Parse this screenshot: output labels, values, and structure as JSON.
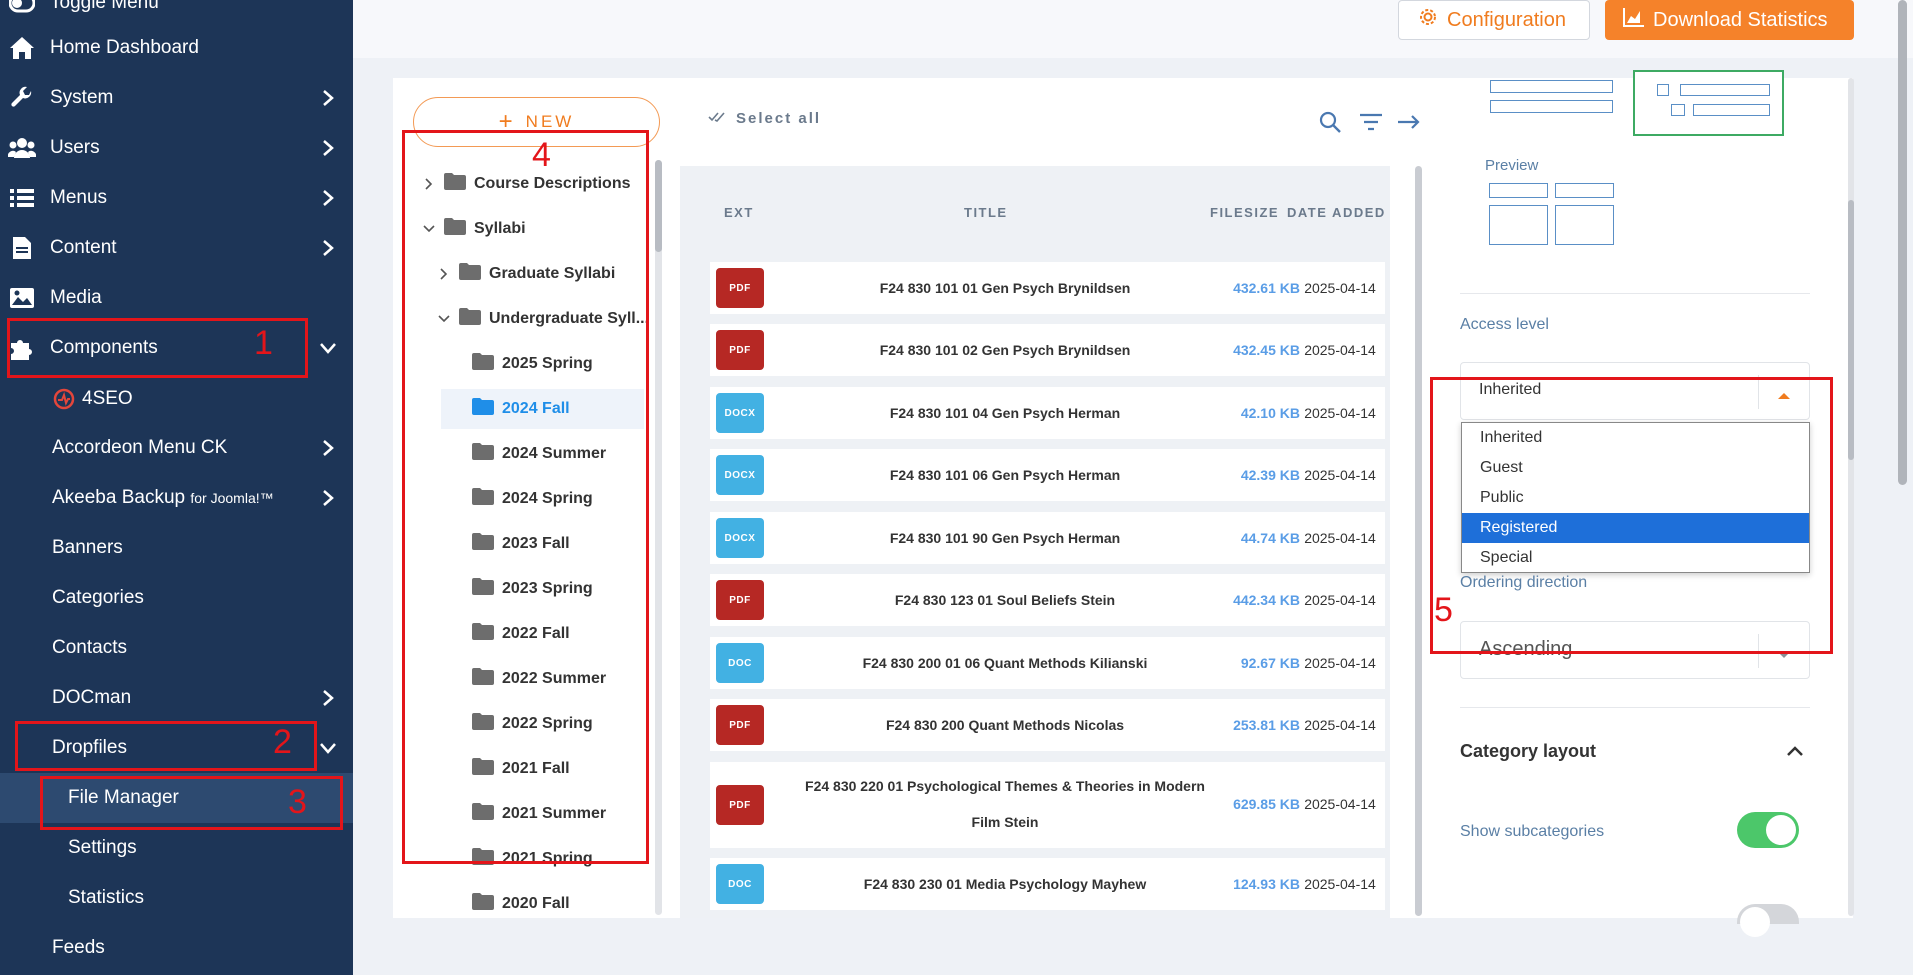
{
  "sidebar": {
    "toggle_label": "Toggle Menu",
    "items": [
      {
        "label": "Home Dashboard",
        "icon": "home-icon",
        "chevron": ""
      },
      {
        "label": "System",
        "icon": "wrench-icon",
        "chevron": "right"
      },
      {
        "label": "Users",
        "icon": "users-icon",
        "chevron": "right"
      },
      {
        "label": "Menus",
        "icon": "list-icon",
        "chevron": "right"
      },
      {
        "label": "Content",
        "icon": "document-icon",
        "chevron": "right"
      },
      {
        "label": "Media",
        "icon": "image-icon",
        "chevron": ""
      },
      {
        "label": "Components",
        "icon": "puzzle-icon",
        "chevron": "down"
      }
    ],
    "components": [
      {
        "label": "4SEO",
        "suffix": ""
      },
      {
        "label": "Accordeon Menu CK",
        "suffix": ""
      },
      {
        "label": "Akeeba Backup",
        "suffix": "for Joomla!™"
      },
      {
        "label": "Banners",
        "suffix": ""
      },
      {
        "label": "Categories",
        "suffix": ""
      },
      {
        "label": "Contacts",
        "suffix": ""
      },
      {
        "label": "DOCman",
        "suffix": ""
      },
      {
        "label": "Dropfiles",
        "suffix": ""
      }
    ],
    "dropfiles_sub": [
      "File Manager",
      "Settings",
      "Statistics"
    ],
    "feeds": "Feeds"
  },
  "header": {
    "config_label": "Configuration",
    "stats_label": "Download Statistics",
    "accent": "#f5822a"
  },
  "tree": {
    "new_label": "NEW",
    "items": [
      "Course Descriptions",
      "Syllabi",
      "Graduate Syllabi",
      "Undergraduate Syll...",
      "2025 Spring",
      "2024 Fall",
      "2024 Summer",
      "2024 Spring",
      "2023 Fall",
      "2023 Spring",
      "2022 Fall",
      "2022 Summer",
      "2022 Spring",
      "2021 Fall",
      "2021 Summer",
      "2021 Spring",
      "2020 Fall"
    ],
    "selected": "2024 Fall"
  },
  "files": {
    "select_all": "Select all",
    "columns": {
      "ext": "EXT",
      "title": "TITLE",
      "size": "FILESIZE",
      "date": "DATE ADDED"
    },
    "rows": [
      {
        "ext": "PDF",
        "title": "F24 830 101 01 Gen Psych Brynildsen",
        "title2": "",
        "size": "432.61 KB",
        "date": "2025-04-14"
      },
      {
        "ext": "PDF",
        "title": "F24 830 101 02 Gen Psych Brynildsen",
        "title2": "",
        "size": "432.45 KB",
        "date": "2025-04-14"
      },
      {
        "ext": "DOCX",
        "title": "F24 830 101 04 Gen Psych Herman",
        "title2": "",
        "size": "42.10 KB",
        "date": "2025-04-14"
      },
      {
        "ext": "DOCX",
        "title": "F24 830 101 06 Gen Psych Herman",
        "title2": "",
        "size": "42.39 KB",
        "date": "2025-04-14"
      },
      {
        "ext": "DOCX",
        "title": "F24 830 101 90 Gen Psych Herman",
        "title2": "",
        "size": "44.74 KB",
        "date": "2025-04-14"
      },
      {
        "ext": "PDF",
        "title": "F24 830 123 01 Soul Beliefs Stein",
        "title2": "",
        "size": "442.34 KB",
        "date": "2025-04-14"
      },
      {
        "ext": "DOC",
        "title": "F24 830 200 01 06 Quant Methods Kilianski",
        "title2": "",
        "size": "92.67 KB",
        "date": "2025-04-14"
      },
      {
        "ext": "PDF",
        "title": "F24 830 200 Quant Methods Nicolas",
        "title2": "",
        "size": "253.81 KB",
        "date": "2025-04-14"
      },
      {
        "ext": "PDF",
        "title": "F24 830 220 01 Psychological Themes & Theories in Modern",
        "title2": "Film Stein",
        "size": "629.85 KB",
        "date": "2025-04-14"
      },
      {
        "ext": "DOC",
        "title": "F24 830 230 01 Media Psychology Mayhew",
        "title2": "",
        "size": "124.93 KB",
        "date": "2025-04-14"
      }
    ]
  },
  "settings": {
    "preview_label": "Preview",
    "access_label": "Access level",
    "access_value": "Inherited",
    "access_options": [
      "Inherited",
      "Guest",
      "Public",
      "Registered",
      "Special"
    ],
    "access_highlighted": "Registered",
    "ordering_dir_label": "Ordering direction",
    "ordering_dir_value": "Ascending",
    "category_layout_label": "Category layout",
    "show_subcategories_label": "Show subcategories",
    "show_subcategories_on": true
  },
  "annotations": [
    "1",
    "2",
    "3",
    "4",
    "5"
  ]
}
